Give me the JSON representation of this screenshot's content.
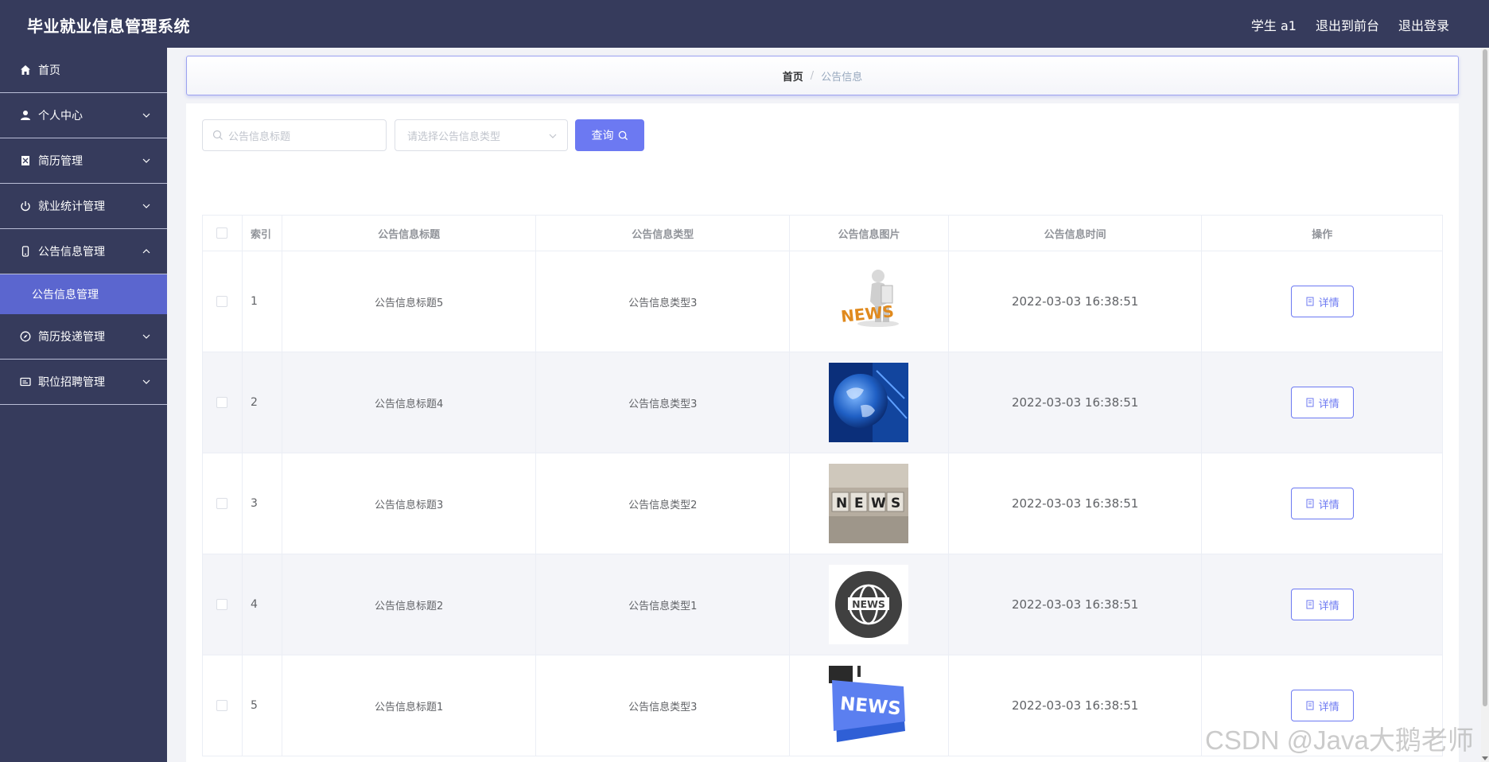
{
  "app": {
    "title": "毕业就业信息管理系统"
  },
  "top_links": {
    "user": "学生 a1",
    "to_front": "退出到前台",
    "logout": "退出登录"
  },
  "sidebar": {
    "items": [
      {
        "label": "首页",
        "icon": "home-icon"
      },
      {
        "label": "个人中心",
        "icon": "user-icon"
      },
      {
        "label": "简历管理",
        "icon": "document-icon"
      },
      {
        "label": "就业统计管理",
        "icon": "power-icon"
      },
      {
        "label": "公告信息管理",
        "icon": "phone-icon",
        "expanded": true,
        "children": [
          {
            "label": "公告信息管理",
            "active": true
          }
        ]
      },
      {
        "label": "简历投递管理",
        "icon": "compass-icon"
      },
      {
        "label": "职位招聘管理",
        "icon": "card-icon"
      }
    ]
  },
  "breadcrumb": {
    "home": "首页",
    "separator": "/",
    "current": "公告信息"
  },
  "search": {
    "title_placeholder": "公告信息标题",
    "type_placeholder": "请选择公告信息类型",
    "query_label": "查询"
  },
  "table": {
    "headers": {
      "index": "索引",
      "title": "公告信息标题",
      "type": "公告信息类型",
      "image": "公告信息图片",
      "time": "公告信息时间",
      "op": "操作"
    },
    "detail_label": "详情",
    "rows": [
      {
        "index": "1",
        "title": "公告信息标题5",
        "type": "公告信息类型3",
        "time": "2022-03-03 16:38:51",
        "image": "news-figure-image"
      },
      {
        "index": "2",
        "title": "公告信息标题4",
        "type": "公告信息类型3",
        "time": "2022-03-03 16:38:51",
        "image": "globe-image"
      },
      {
        "index": "3",
        "title": "公告信息标题3",
        "type": "公告信息类型2",
        "time": "2022-03-03 16:38:51",
        "image": "news-blocks-image"
      },
      {
        "index": "4",
        "title": "公告信息标题2",
        "type": "公告信息类型1",
        "time": "2022-03-03 16:38:51",
        "image": "news-globe-icon-image"
      },
      {
        "index": "5",
        "title": "公告信息标题1",
        "type": "公告信息类型3",
        "time": "2022-03-03 16:38:51",
        "image": "news-key-image"
      }
    ]
  },
  "watermark": "CSDN @Java大鹅老师",
  "colors": {
    "header_bg": "#363b5c",
    "accent": "#6c79f2",
    "active_menu": "#5b66cf"
  }
}
